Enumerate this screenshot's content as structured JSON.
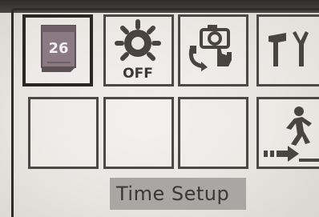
{
  "menu": {
    "items": [
      {
        "id": "date",
        "icon": "calendar-icon",
        "text": "26"
      },
      {
        "id": "led-off",
        "icon": "sun-off-icon",
        "text": "OFF"
      },
      {
        "id": "camera-touch",
        "icon": "camera-touch-icon"
      },
      {
        "id": "tools",
        "icon": "tools-icon"
      },
      {
        "id": "empty-1"
      },
      {
        "id": "empty-2"
      },
      {
        "id": "empty-3"
      },
      {
        "id": "exit",
        "icon": "exit-icon"
      }
    ],
    "selected_label": "Time Setup"
  },
  "colors": {
    "calendar": "#8c7a83",
    "icon_dark": "#4a4441",
    "label_bg": "#a9a6a3"
  }
}
